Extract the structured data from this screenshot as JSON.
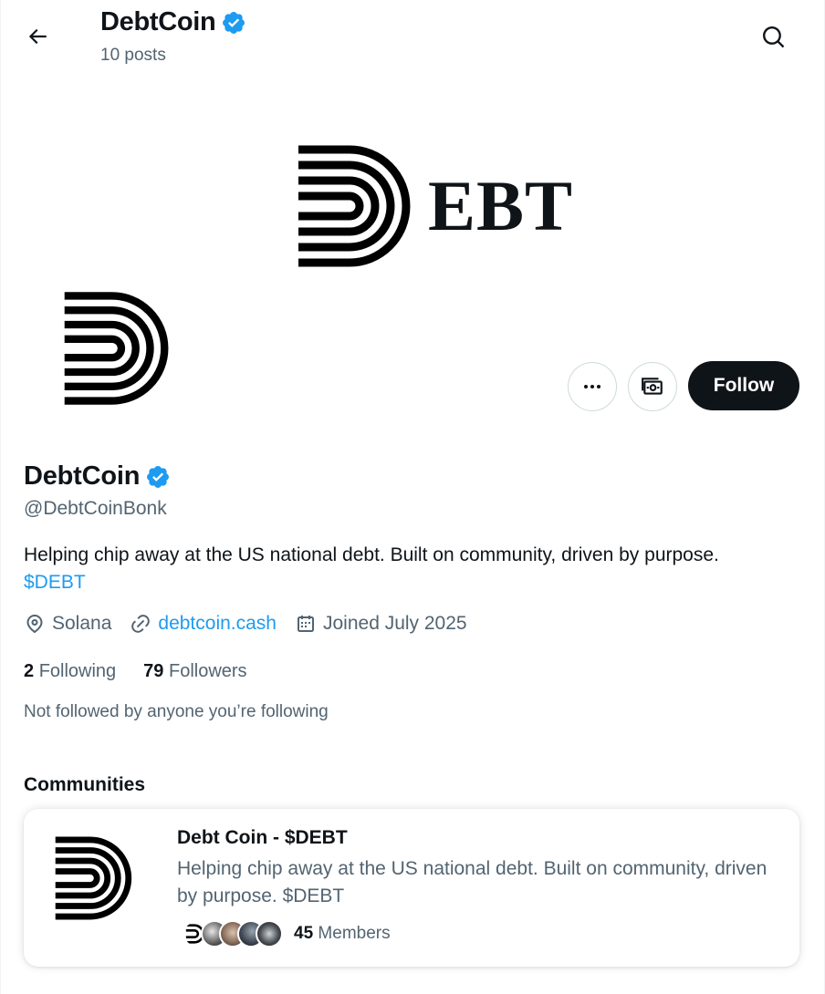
{
  "header": {
    "title": "DebtCoin",
    "post_count": "10 posts"
  },
  "banner": {
    "logo_text": "EBT"
  },
  "profile": {
    "name": "DebtCoin",
    "handle": "@DebtCoinBonk",
    "bio": "Helping chip away at the US national debt. Built on community, driven by purpose.",
    "bio_link": "$DEBT",
    "location": "Solana",
    "website": "debtcoin.cash",
    "joined": "Joined July 2025",
    "following_count": "2",
    "following_label": "Following",
    "followers_count": "79",
    "followers_label": "Followers",
    "not_followed_text": "Not followed by anyone you’re following"
  },
  "actions": {
    "follow_label": "Follow",
    "more_icon": "ellipsis-icon",
    "tip_icon": "money-icon"
  },
  "communities": {
    "heading": "Communities",
    "items": [
      {
        "name": "Debt Coin - $DEBT",
        "description": "Helping chip away at the US national debt. Built on community, driven by purpose. $DEBT",
        "member_count": "45",
        "member_label": "Members"
      }
    ]
  },
  "colors": {
    "accent": "#1d9bf0",
    "text": "#0f1419",
    "secondary_text": "#536471",
    "follow_bg": "#0f1419",
    "verified": "#1d9bf0"
  }
}
